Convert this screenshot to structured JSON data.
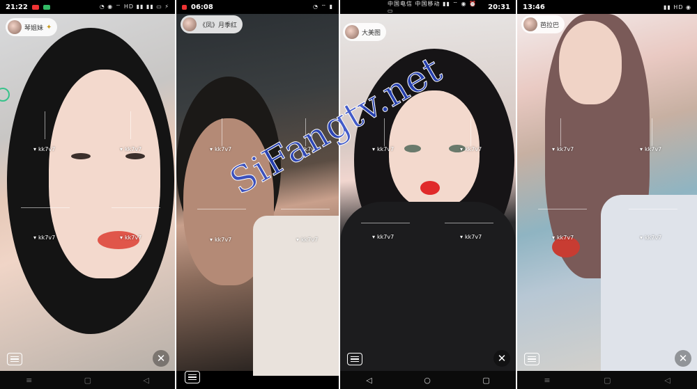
{
  "watermark": {
    "text": "SiFangtv.net"
  },
  "stamp": {
    "text": "kk7v7"
  },
  "panels": [
    {
      "status": {
        "time": "21:22",
        "icons": "◔ ◉ ⌔ HD ▮▮ ▮▮ ▭ ⚡"
      },
      "host": {
        "name": "琴姐妹"
      },
      "chat_icon": "chat-icon",
      "close_icon": "✕"
    },
    {
      "status": {
        "time": "06:08",
        "icons": "◔ ⌔ ▮"
      },
      "host": {
        "name": "《凤》月季红"
      },
      "chat_icon": "chat-icon",
      "close_icon": ""
    },
    {
      "status": {
        "time": "20:31",
        "icons": "中国电信 中国移动 ▮▮ ⌔ ◉ ⏰ ▭"
      },
      "host": {
        "name": "大美图"
      },
      "chat_icon": "chat-icon",
      "close_icon": "✕"
    },
    {
      "status": {
        "time": "13:46",
        "icons": "▮▮ HD ◉"
      },
      "host": {
        "name": "芭拉巴"
      },
      "chat_icon": "chat-icon",
      "close_icon": "✕"
    }
  ],
  "navbar": {
    "menu": "≡",
    "home": "▢",
    "back": "◁",
    "home_circle": "○",
    "recent": "▢"
  }
}
